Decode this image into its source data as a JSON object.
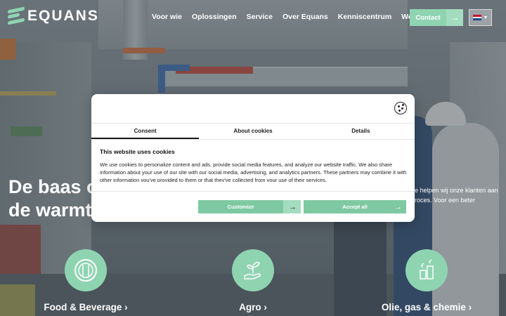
{
  "header": {
    "logo_text": "EQUANS",
    "nav": [
      "Voor wie",
      "Oplossingen",
      "Service",
      "Over Equans",
      "Kenniscentrum",
      "Werken bij"
    ],
    "contact_label": "Contact",
    "language_flag": "nl-flag-icon"
  },
  "hero": {
    "title_line1": "De baas o",
    "title_line2": "de warmt",
    "subtitle_line1": "e helpen wij onze klanten aan",
    "subtitle_line2": "roces. Voor een beter"
  },
  "categories": [
    {
      "label": "Food & Beverage",
      "icon": "cutlery-icon"
    },
    {
      "label": "Agro",
      "icon": "plant-hand-icon"
    },
    {
      "label": "Olie, gas & chemie",
      "icon": "refinery-icon"
    }
  ],
  "cookie_dialog": {
    "tabs": [
      "Consent",
      "About cookies",
      "Details"
    ],
    "active_tab": "Consent",
    "title": "This website uses cookies",
    "body": "We use cookies to personalize content and ads, provide social media features, and analyze our website traffic. We also share information about your use of our site with our social media, advertising, and analytics partners. These partners may combine it with other information you've provided to them or that they've collected from your use of their services.",
    "customize_label": "Customize",
    "accept_label": "Accept all"
  },
  "colors": {
    "accent_green": "#8fd4b1",
    "button_green": "#7fc9a2"
  }
}
